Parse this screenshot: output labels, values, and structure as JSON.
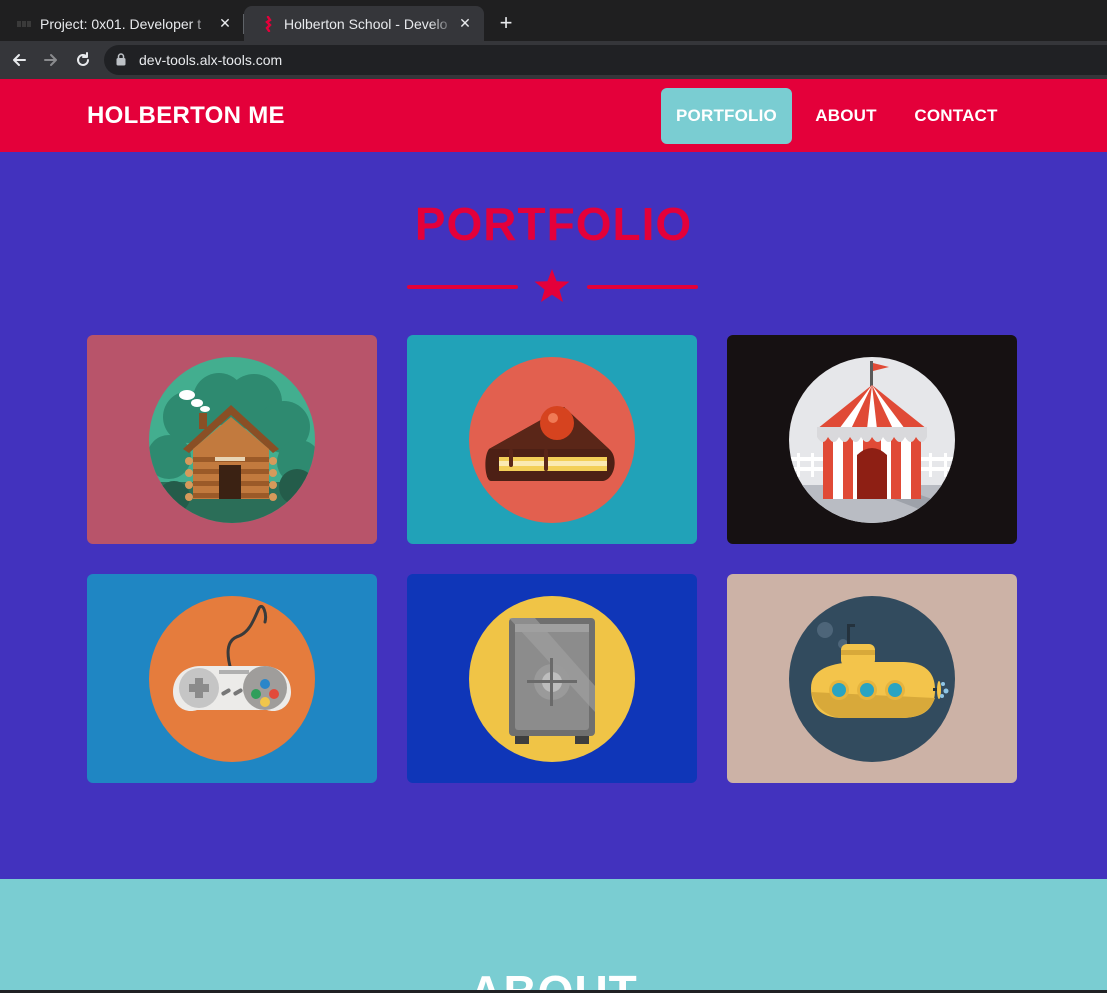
{
  "browser": {
    "tabs": [
      {
        "title": "Project: 0x01. Developer t",
        "state": "inactive"
      },
      {
        "title": "Holberton School - Develo",
        "state": "active"
      }
    ],
    "new_tab_label": "+",
    "close_label": "✕",
    "url": "dev-tools.alx-tools.com"
  },
  "navbar": {
    "brand": "HOLBERTON ME",
    "links": [
      {
        "label": "PORTFOLIO",
        "active": true
      },
      {
        "label": "ABOUT",
        "active": false
      },
      {
        "label": "CONTACT",
        "active": false
      }
    ]
  },
  "portfolio": {
    "title": "PORTFOLIO",
    "items": [
      {
        "icon": "cabin-icon",
        "card_color": "#b8546a",
        "disc_color": "#43ae8f"
      },
      {
        "icon": "cake-icon",
        "card_color": "#21a2b8",
        "disc_color": "#e2604f"
      },
      {
        "icon": "circus-tent-icon",
        "card_color": "#161112",
        "disc_color": "#e6e7ea"
      },
      {
        "icon": "game-controller-icon",
        "card_color": "#1f86c3",
        "disc_color": "#e57c3d"
      },
      {
        "icon": "safe-icon",
        "card_color": "#0f36b8",
        "disc_color": "#f0c446"
      },
      {
        "icon": "submarine-icon",
        "card_color": "#ccb2a6",
        "disc_color": "#324b5e"
      }
    ]
  },
  "about": {
    "title": "ABOUT"
  },
  "colors": {
    "primary": "#e4003a",
    "accent": "#7acdd2",
    "background": "#4232be"
  }
}
